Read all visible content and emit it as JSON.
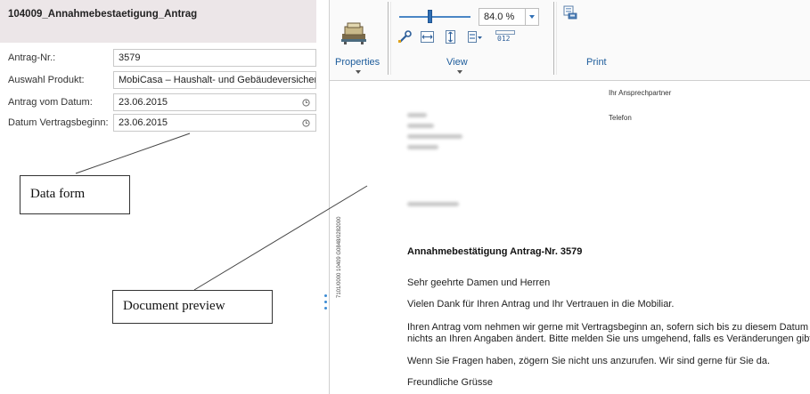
{
  "form": {
    "title": "104009_Annahmebestaetigung_Antrag",
    "fields": [
      {
        "label": "Antrag-Nr.:",
        "value": "3579"
      },
      {
        "label": "Auswahl Produkt:",
        "value": "MobiCasa – Haushalt- und Gebäudeversicherung"
      },
      {
        "label": "Antrag vom Datum:",
        "value": "23.06.2015"
      },
      {
        "label": "Datum Vertragsbeginn:",
        "value": "23.06.2015"
      }
    ]
  },
  "annotations": {
    "data_form": "Data form",
    "document_preview": "Document preview"
  },
  "ribbon": {
    "groups": {
      "properties": "Properties",
      "view": "View",
      "print": "Print"
    },
    "zoom_value": "84.0 %",
    "icons": [
      "properties-icon",
      "wrench-icon",
      "fit-width-icon",
      "fit-page-icon",
      "page-layout-icon",
      "field-codes-icon",
      "print-icon"
    ]
  },
  "document": {
    "contact_label": "Ihr Ansprechpartner",
    "phone_label": "Telefon",
    "heading": "Annahmebestätigung Antrag-Nr. 3579",
    "salutation": "Sehr geehrte Damen und Herren",
    "thanks": "Vielen Dank für Ihren Antrag und Ihr Vertrauen in die Mobiliar.",
    "para1_line1": "Ihren Antrag vom  nehmen wir gerne mit Vertragsbeginn  an, sofern sich bis zu diesem Datum",
    "para1_line2": "nichts an Ihren Angaben ändert. Bitte melden Sie uns umgehend, falls es Veränderungen gibt.",
    "para2": "Wenn Sie Fragen haben, zögern Sie nicht uns anzurufen. Wir sind gerne für Sie da.",
    "closing": "Freundliche Grüsse",
    "side_code": "7101/0000 10409 G0848/0282000"
  }
}
